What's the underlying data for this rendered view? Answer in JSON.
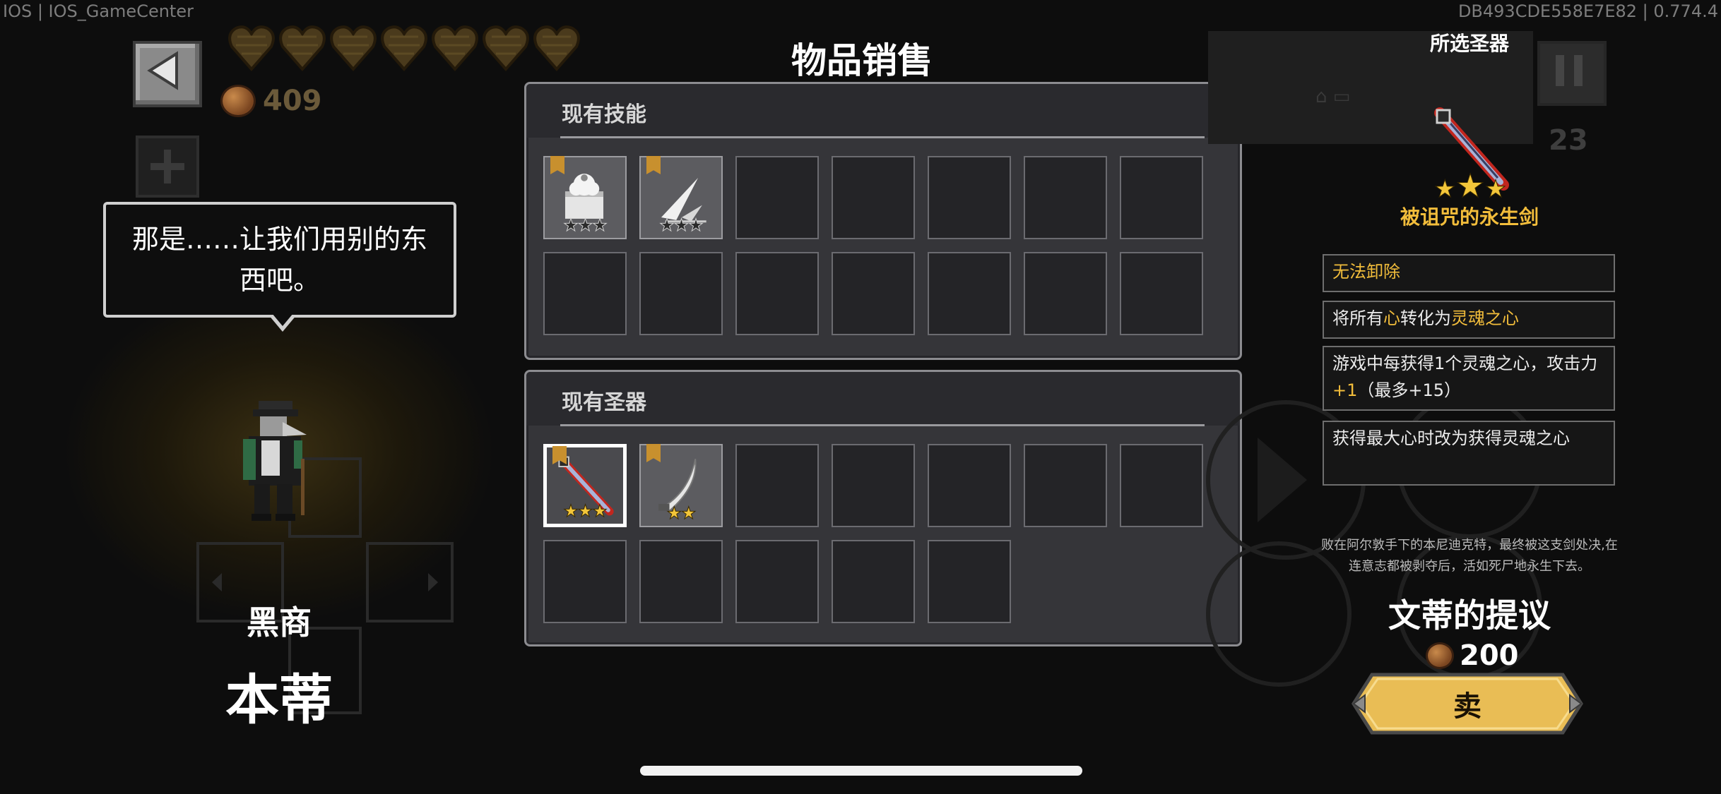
{
  "debug": {
    "left": "IOS | IOS_GameCenter",
    "right": "DB493CDE558E7E82 | 0.774.4"
  },
  "player": {
    "coins": "409",
    "hearts": 7,
    "enemy_count": "23"
  },
  "dialogue": {
    "text": "那是……让我们用别的东西吧。"
  },
  "npc": {
    "role": "黑商",
    "name": "本蒂"
  },
  "screen_title": "物品销售",
  "skills_panel": {
    "title": "现有技能",
    "slots": [
      {
        "item": "cake-icon",
        "stars": "★★★",
        "stars_style": "gray",
        "badge": true
      },
      {
        "item": "slash-effect-icon",
        "stars": "★★★",
        "stars_style": "gray",
        "badge": true
      }
    ],
    "slot_count": 14
  },
  "relics_panel": {
    "title": "现有圣器",
    "slots": [
      {
        "item": "cursed-sword-icon",
        "stars": "★★★",
        "stars_style": "gold",
        "badge": true,
        "selected": true
      },
      {
        "item": "curved-blade-icon",
        "stars": "★★",
        "stars_style": "gold",
        "badge": true
      }
    ],
    "slot_count": 12
  },
  "selected": {
    "header": "所选圣器",
    "name": "被诅咒的永生剑",
    "effects": [
      {
        "parts": [
          {
            "t": "无法卸除",
            "c": "gold"
          }
        ]
      },
      {
        "parts": [
          {
            "t": "将所有",
            "c": "white"
          },
          {
            "t": "心",
            "c": "gold"
          },
          {
            "t": "转化为",
            "c": "white"
          },
          {
            "t": "灵魂之心",
            "c": "gold"
          }
        ]
      },
      {
        "parts": [
          {
            "t": "游戏中每获得1个灵魂之心，攻击力",
            "c": "white"
          },
          {
            "t": "+1",
            "c": "gold"
          },
          {
            "t": "（最多+15）",
            "c": "white"
          }
        ]
      },
      {
        "parts": [
          {
            "t": "获得最大心时改为获得灵魂之心",
            "c": "white"
          }
        ]
      }
    ],
    "lore": "败在阿尔敦手下的本尼迪克特，最终被这支剑处决,在连意志都被剥夺后，活如死尸地永生下去。",
    "offer_title": "文蒂的提议",
    "price": "200",
    "sell_label": "卖"
  },
  "colors": {
    "accent_gold": "#f2bd3b",
    "panel_bg": "#353539",
    "slot_bg": "#242427",
    "sell_button": "#e8b94a"
  }
}
